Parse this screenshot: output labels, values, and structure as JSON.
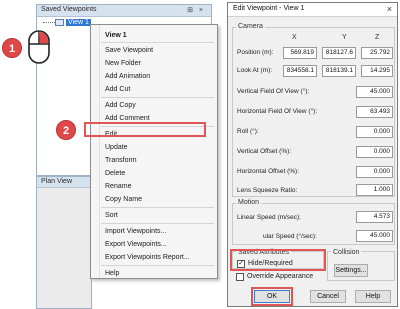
{
  "saved_viewpoints": {
    "title": "Saved Viewpoints",
    "title_controls": "⊞ ×",
    "tree_item": "View 1"
  },
  "plan_view": {
    "title": "Plan View"
  },
  "context_menu": {
    "header": "View 1",
    "items": {
      "save_viewpoint": "Save Viewpoint",
      "new_folder": "New Folder",
      "add_animation": "Add Animation",
      "add_cut": "Add Cut",
      "add_copy": "Add Copy",
      "add_comment": "Add Comment",
      "edit": "Edit",
      "update": "Update",
      "transform": "Transform",
      "delete": "Delete",
      "rename": "Rename",
      "copy_name": "Copy Name",
      "sort": "Sort",
      "import_viewpoints": "Import Viewpoints...",
      "export_viewpoints": "Export Viewpoints...",
      "export_viewpoints_report": "Export Viewpoints Report...",
      "help": "Help"
    }
  },
  "dialog": {
    "title": "Edit Viewpoint - View 1",
    "close_glyph": "×",
    "camera": {
      "label": "Camera",
      "col_x": "X",
      "col_y": "Y",
      "col_z": "Z",
      "position_label": "Position (m):",
      "position_x": "569.819",
      "position_y": "818127.6",
      "position_z": "25.792",
      "look_at_label": "Look At (m):",
      "look_at_x": "834558.1",
      "look_at_y": "818139.1",
      "look_at_z": "14.295",
      "vfov_label": "Vertical Field Of View (°):",
      "vfov_value": "45.000",
      "hfov_label": "Horizontal Field Of View (°):",
      "hfov_value": "63.493",
      "roll_label": "Roll (°):",
      "roll_value": "0.000",
      "voffset_label": "Vertical Offset (%):",
      "voffset_value": "0.000",
      "hoffset_label": "Horizontal Offset (%):",
      "hoffset_value": "0.000",
      "lens_label": "Lens Squeeze Ratio:",
      "lens_value": "1.000"
    },
    "motion": {
      "label": "Motion",
      "linear_label": "Linear Speed (m/sec):",
      "linear_value": "4.573",
      "angular_label": "ular Speed (°/sec):",
      "angular_value": "45.000"
    },
    "saved_attributes": {
      "label": "Saved Attributes",
      "hide_required_label": "Hide/Required",
      "hide_required_checked": true,
      "override_label": "Override Appearance",
      "override_checked": false
    },
    "collision": {
      "label": "Collision",
      "settings_button": "Settings..."
    },
    "buttons": {
      "ok": "OK",
      "cancel": "Cancel",
      "help": "Help"
    }
  },
  "steps": {
    "step1": "1",
    "step2": "2",
    "step3": "3",
    "step4": "4"
  },
  "colors": {
    "badge": "#e04848",
    "highlight_box": "#e05555",
    "selection": "#3078d6"
  }
}
